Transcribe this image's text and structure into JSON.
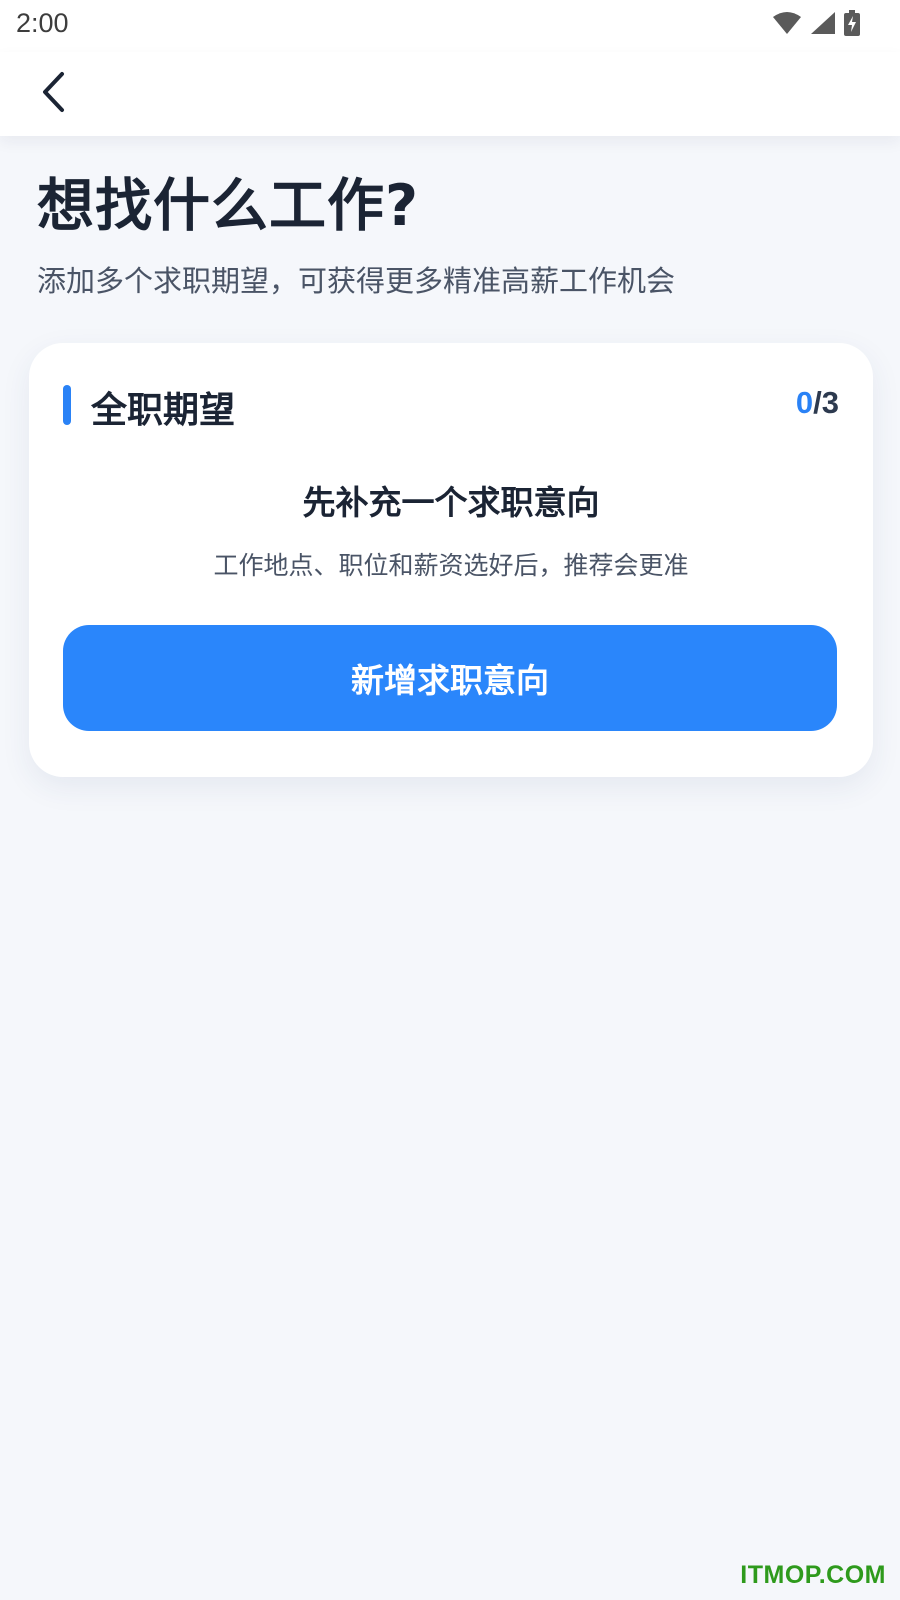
{
  "status_bar": {
    "time": "2:00",
    "icons": [
      "wifi-icon",
      "signal-icon",
      "battery-charging-icon"
    ]
  },
  "nav": {
    "back_icon": "chevron-left-icon"
  },
  "header": {
    "title": "想找什么工作?",
    "subtitle": "添加多个求职期望，可获得更多精准高薪工作机会"
  },
  "card": {
    "title": "全职期望",
    "count_current": "0",
    "count_total": "/3",
    "heading": "先补充一个求职意向",
    "hint": "工作地点、职位和薪资选好后，推荐会更准",
    "button_label": "新增求职意向"
  },
  "watermark": "ITMOP.COM",
  "colors": {
    "accent": "#2a82f6",
    "background": "#f5f7fb",
    "watermark": "#2e9a1c"
  }
}
